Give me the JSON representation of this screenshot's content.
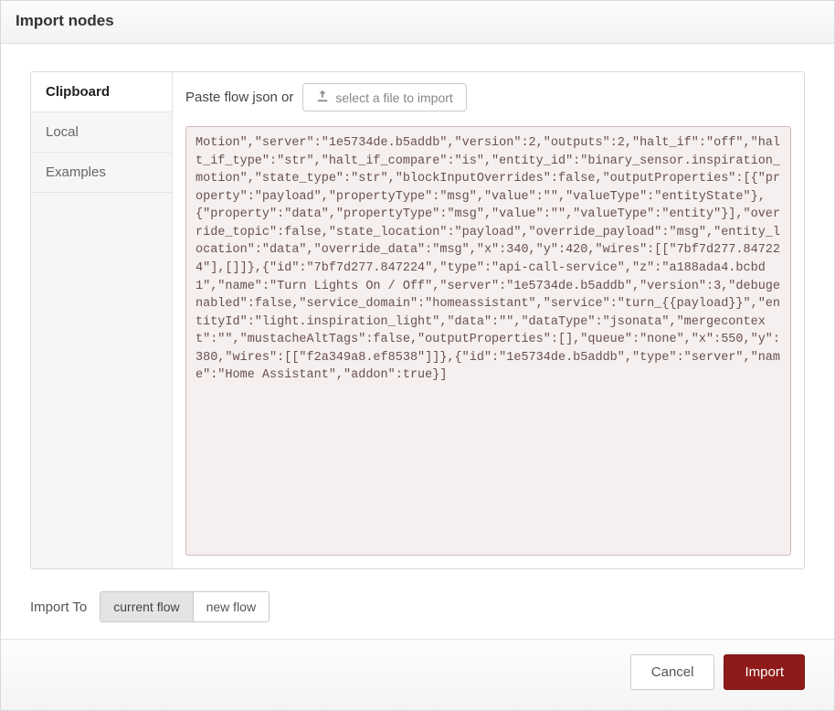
{
  "dialog": {
    "title": "Import nodes"
  },
  "sidebar": {
    "tabs": [
      {
        "label": "Clipboard",
        "active": true
      },
      {
        "label": "Local",
        "active": false
      },
      {
        "label": "Examples",
        "active": false
      }
    ]
  },
  "main": {
    "paste_label": "Paste flow json or",
    "file_button_label": "select a file to import",
    "json_value": "Motion\",\"server\":\"1e5734de.b5addb\",\"version\":2,\"outputs\":2,\"halt_if\":\"off\",\"halt_if_type\":\"str\",\"halt_if_compare\":\"is\",\"entity_id\":\"binary_sensor.inspiration_motion\",\"state_type\":\"str\",\"blockInputOverrides\":false,\"outputProperties\":[{\"property\":\"payload\",\"propertyType\":\"msg\",\"value\":\"\",\"valueType\":\"entityState\"},{\"property\":\"data\",\"propertyType\":\"msg\",\"value\":\"\",\"valueType\":\"entity\"}],\"override_topic\":false,\"state_location\":\"payload\",\"override_payload\":\"msg\",\"entity_location\":\"data\",\"override_data\":\"msg\",\"x\":340,\"y\":420,\"wires\":[[\"7bf7d277.847224\"],[]]},{\"id\":\"7bf7d277.847224\",\"type\":\"api-call-service\",\"z\":\"a188ada4.bcbd1\",\"name\":\"Turn Lights On / Off\",\"server\":\"1e5734de.b5addb\",\"version\":3,\"debugenabled\":false,\"service_domain\":\"homeassistant\",\"service\":\"turn_{{payload}}\",\"entityId\":\"light.inspiration_light\",\"data\":\"\",\"dataType\":\"jsonata\",\"mergecontext\":\"\",\"mustacheAltTags\":false,\"outputProperties\":[],\"queue\":\"none\",\"x\":550,\"y\":380,\"wires\":[[\"f2a349a8.ef8538\"]]},{\"id\":\"1e5734de.b5addb\",\"type\":\"server\",\"name\":\"Home Assistant\",\"addon\":true}]"
  },
  "import_to": {
    "label": "Import To",
    "options": [
      {
        "label": "current flow",
        "active": true
      },
      {
        "label": "new flow",
        "active": false
      }
    ]
  },
  "footer": {
    "cancel": "Cancel",
    "import": "Import"
  }
}
